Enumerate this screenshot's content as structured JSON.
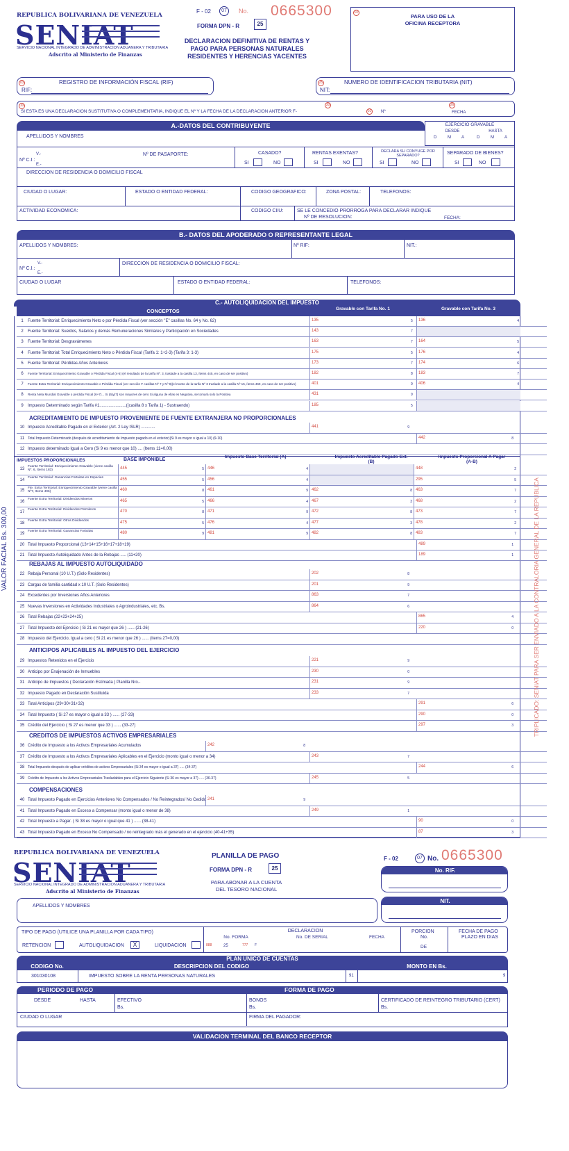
{
  "header": {
    "republic": "REPUBLICA BOLIVARIANA DE VENEZUELA",
    "logo": "SENIAT",
    "service": "SERVICIO NACIONAL INTEGRADO DE ADMINISTRACION ADUANERA Y TRIBUTARIA",
    "ministry": "Adscrito al Ministerio de Finanzas",
    "form_code": "F - 02",
    "circle_07": "07",
    "no_label": "No.",
    "serial": "0665300",
    "forma_label": "FORMA  DPN - R",
    "forma_num": "25",
    "title_1": "DECLARACION DEFINITIVA DE RENTAS Y",
    "title_2": "PAGO PARA PERSONAS NATURALES",
    "title_3": "RESIDENTES Y HERENCIAS YACENTES",
    "office_circle": "02",
    "office_1": "PARA USO DE LA",
    "office_2": "OFICINA RECEPTORA"
  },
  "ids": {
    "rif_title": "REGISTRO DE INFORMACIÓN FISCAL (RIF)",
    "rif_label": "RIF:",
    "rif_circle": "03",
    "nit_title": "NUMERO DE IDENTIFICACION TRIBUTARIA (NIT)",
    "nit_label": "NIT:",
    "nit_circle": "25",
    "sustitutiva": "SI ESTA ES UNA DECLARACION SUSTITUTIVA O COMPLEMENTARIA, INDIQUE EL Nº Y LA FECHA DE LA DECLARACION ANTERIOR F-",
    "sust_no": "Nº",
    "sust_fecha": "FECHA",
    "sust_circle_a": "10",
    "sust_circle_b": "30",
    "sust_circle_c": "01",
    "sust_circle_d": "26"
  },
  "sectionA": {
    "title": "A.-DATOS DEL CONTRIBUYENTE",
    "ejercicio": "EJERCICIO GRAVABLE",
    "desde": "DESDE",
    "hasta": "HASTA",
    "dma": [
      "D",
      "M",
      "A",
      "D",
      "M",
      "A"
    ],
    "apellidos": "APELLIDOS Y NOMBRES",
    "ci": "Nº C.I.:",
    "v": "V.-",
    "e": "E.-",
    "pasaporte": "Nº DE PASAPORTE:",
    "casado": "CASADO?",
    "exentas": "RENTAS EXENTAS?",
    "declara": "DECLARA SU CONYUGE POR SEPARADO?",
    "separado": "SEPARADO DE BIENES?",
    "si": "SI",
    "no": "NO",
    "direccion": "DIRECCION DE RESIDENCIA O DOMICILIO FISCAL",
    "ciudad": "CIUDAD O LUGAR:",
    "estado": "ESTADO O ENTIDAD FEDERAL:",
    "codigo_geo": "CODIGO GEOGRAFICO:",
    "zona": "ZONA POSTAL:",
    "telefonos": "TELEFONOS:",
    "actividad": "ACTIVIDAD ECONOMICA:",
    "ciiu": "CODIGO CIIU:",
    "prorroga": "SE LE CONCEDIO PRORROGA PARA DECLARAR INDIQUE",
    "resolucion": "Nº DE RESOLUCION:",
    "fecha": "FECHA:"
  },
  "sectionB": {
    "title": "B.- DATOS DEL APODERADO O REPRESENTANTE LEGAL",
    "apellidos": "APELLIDOS Y NOMBRES:",
    "rif": "Nº RIF:",
    "nit": "NIT.:",
    "ci": "Nº C.I.:",
    "v": "V.-",
    "e": "E.-",
    "direccion": "DIRECCION DE RESIDENCIA O DOMICILIO FISCAL:",
    "ciudad": "CIUDAD O LUGAR",
    "estado": "ESTADO O ENTIDAD FEDERAL:",
    "telefonos": "TELEFONOS:"
  },
  "sectionC": {
    "title": "C.- AUTOLIQUIDACION DEL IMPUESTO",
    "conceptos": "CONCEPTOS",
    "tarifa1": "Gravable con Tarifa No. 1",
    "tarifa3": "Gravable con Tarifa No. 3",
    "rows_a": [
      {
        "n": "1",
        "label": "Fuente Territorial: Enriquecimiento Neto o por Pérdida Fiscal (ver sección \"E\" casillas No. 64 y No. 62)",
        "c1": "135",
        "d1": "5",
        "c3": "136",
        "d3": "4"
      },
      {
        "n": "2",
        "label": "Fuente Territorial: Sueldos, Salarios y demás Remuneraciones Similares y Participación en Sociedades",
        "c1": "143",
        "d1": "7",
        "c3": "",
        "d3": ""
      },
      {
        "n": "3",
        "label": "Fuente Territorial: Desgravámenes",
        "c1": "163",
        "d1": "7",
        "c3": "164",
        "d3": "5"
      },
      {
        "n": "4",
        "label": "Fuente Territorial: Total Enriquecimiento Neto o Pérdida Fiscal (Tarifa 1: 1+2-3) (Tarifa 3: 1-3)",
        "c1": "175",
        "d1": "5",
        "c3": "176",
        "d3": "4"
      },
      {
        "n": "5",
        "label": "Fuente Territorial: Pérdidas Años Anteriores",
        "c1": "173",
        "d1": "7",
        "c3": "174",
        "d3": "6"
      },
      {
        "n": "6",
        "label": "Fuente Territorial: Enriquecimiento Gravable o Pérdida Fiscal     (4-5) (el resultado de la tarifa Nº. 3, traslade a la casilla 13, ítems 445, en caso de ser positivo)",
        "c1": "182",
        "d1": "8",
        "c3": "183",
        "d3": "7"
      },
      {
        "n": "7",
        "label": "Fuente Extra Territorial: Enriquecimiento Gravable o Pérdida Fiscal (ver sección F casillas Nº 7 y Nº 8)(el monto de la tarifa Nº 3 traslade a la casilla Nº 15, ítems 460, en caso de ser positivo)",
        "c1": "401",
        "d1": "9",
        "c3": "406",
        "d3": "4"
      },
      {
        "n": "8",
        "label": "Renta Neta Mundial Gravable o pérdida Fiscal          (6+7)... Si (6)y(7) son mayores de cero          Si alguna de ellas es Negativa, se tomará solo la Positiva",
        "c1": "431",
        "d1": "9",
        "c3": "",
        "d3": ""
      },
      {
        "n": "9",
        "label": "Impuesto Determinado según Tarifa #1.......................((casilla 8 x Tarifa 1) - Sustraendo)",
        "c1": "185",
        "d1": "5",
        "c3": "",
        "d3": ""
      }
    ],
    "acred_title": "ACREDITAMIENTO DE IMPUESTO PROVENIENTE DE FUENTE EXTRANJERA NO PROPORCIONALES",
    "rows_b": [
      {
        "n": "10",
        "label": "Impuesto Acreditable Pagado en el Exterior (Art. 2 Ley ISLR) ............",
        "c": "441",
        "d": "9",
        "pos": "mid"
      },
      {
        "n": "11",
        "label": "Total Impuesto Determinado (después de acreditamiento de Impuesto pagado en el exterior)(Si 9 es mayor o igual a 10)    (9-10)",
        "c": "442",
        "d": "8",
        "pos": "right"
      },
      {
        "n": "12",
        "label": "Impuesto determinado Igual a Cero (Si 9 es menor que 10) .... (Items 11=0,00)",
        "c": "",
        "d": "",
        "pos": "none"
      }
    ],
    "prop_header": {
      "impuestos": "IMPUESTOS PROPORCIONALES",
      "base": "BASE IMPONIBLE",
      "territorial": "Impuesto Base Territorial (A)",
      "acreditable": "Impuesto Acreditable Pagado Ext. (B)",
      "proporcional": "Impuesto Proporcional A Pagar (A-B)"
    },
    "rows_prop": [
      {
        "n": "13",
        "label": "Fuente Territorial: Enriquecimiento Gravable (viene casilla Nº. 6, Items 183)",
        "b": "445",
        "bd": "5",
        "t": "446",
        "td": "4",
        "a": "",
        "ad": "",
        "p": "448",
        "pd": "2"
      },
      {
        "n": "14",
        "label": "Fuente Territorial: Ganancias Fortuitas en Especies",
        "b": "455",
        "bd": "5",
        "t": "456",
        "td": "4",
        "a": "",
        "ad": "",
        "p": "295",
        "pd": "5"
      },
      {
        "n": "15",
        "label": "Fte. Extra Territorial: Enriquecimiento Gravable (viene casilla Nº7, Items 406)",
        "b": "460",
        "bd": "8",
        "t": "461",
        "td": "9",
        "a": "462",
        "ad": "8",
        "p": "463",
        "pd": "7"
      },
      {
        "n": "16",
        "label": "Fuente Extra Territorial: Dividendos Mineros",
        "b": "465",
        "bd": "5",
        "t": "466",
        "td": "4",
        "a": "467",
        "ad": "3",
        "p": "468",
        "pd": "2"
      },
      {
        "n": "17",
        "label": "Fuente Extra Territorial: Dividendos Petroleros",
        "b": "470",
        "bd": "8",
        "t": "471",
        "td": "9",
        "a": "472",
        "ad": "8",
        "p": "473",
        "pd": "7"
      },
      {
        "n": "18",
        "label": "Fuente Extra Territorial: Otros Dividendos",
        "b": "475",
        "bd": "5",
        "t": "476",
        "td": "4",
        "a": "477",
        "ad": "3",
        "p": "478",
        "pd": "2"
      },
      {
        "n": "19",
        "label": "Fuente Extra Territorial: Ganancias Fortuitas",
        "b": "480",
        "bd": "9",
        "t": "481",
        "td": "9",
        "a": "482",
        "ad": "8",
        "p": "483",
        "pd": "7"
      }
    ],
    "rows_tot": [
      {
        "n": "20",
        "label": "Total Impuesto Proporcional (13+14+15+16+17+18+19)",
        "c": "489",
        "d": "1",
        "pos": "right"
      },
      {
        "n": "21",
        "label": "Total Impuesto Autoliquidado Antes de la Rebajas ..... (11+20)",
        "c": "189",
        "d": "1",
        "pos": "right"
      }
    ],
    "rebajas_title": "REBAJAS AL IMPUESTO AUTOLIQUIDADO",
    "rows_reb": [
      {
        "n": "22",
        "label": "Rebaja Personal (10 U.T.) (Solo Residentes)",
        "c": "202",
        "d": "8",
        "pos": "mid"
      },
      {
        "n": "23",
        "label": "Cargas de familia cantidad     x 10 U.T. (Solo Residentes)",
        "c": "201",
        "d": "9",
        "pos": "mid"
      },
      {
        "n": "24",
        "label": "Excedentes por Inversiones Años Anteriores",
        "c": "863",
        "d": "7",
        "pos": "mid"
      },
      {
        "n": "25",
        "label": "Nuevas Inversiones en Actividades Industriales o Agroindustriales, etc. Bs.",
        "c": "864",
        "d": "6",
        "pos": "mid"
      },
      {
        "n": "26",
        "label": "Total Rebajas           (22+23+24+25)",
        "c": "865",
        "d": "4",
        "pos": "right"
      },
      {
        "n": "27",
        "label": "Total Impuesto del Ejercicio ( Si 21 es mayor que 26 ) ...... (21-26)",
        "c": "220",
        "d": "0",
        "pos": "right"
      },
      {
        "n": "28",
        "label": "Impuesto del Ejercicio, Igual a cero ( Si 21 es menor que 26 ) ...... (Items 27=0,00)",
        "c": "",
        "d": "",
        "pos": "none"
      }
    ],
    "anticipos_title": "ANTICIPOS APLICABLES AL IMPUESTO DEL EJERCICIO",
    "rows_ant": [
      {
        "n": "29",
        "label": "Impuestos Retenidos en el Ejercicio",
        "c": "221",
        "d": "9",
        "pos": "mid"
      },
      {
        "n": "30",
        "label": "Anticipo por Enajenación de Inmuebles",
        "c": "230",
        "d": "0",
        "pos": "mid"
      },
      {
        "n": "31",
        "label": "Anticipo de Impuestos ( Declaración Estimada ) Planilla Nro.-",
        "c": "231",
        "d": "9",
        "pos": "mid"
      },
      {
        "n": "32",
        "label": "Impuesto Pagado en Declaración Sustituida",
        "c": "233",
        "d": "7",
        "pos": "mid"
      },
      {
        "n": "33",
        "label": "Total Anticipos          (29+30+31+32)",
        "c": "291",
        "d": "6",
        "pos": "right"
      },
      {
        "n": "34",
        "label": "Total Impuesto ( Si 27 es mayor o igual a 33 ) ...... (27-33)",
        "c": "290",
        "d": "0",
        "pos": "right"
      },
      {
        "n": "35",
        "label": "Crédito del Ejercicio ( Si 27 es menor que 33 ) ...... (33-27)",
        "c": "297",
        "d": "3",
        "pos": "right"
      }
    ],
    "creditos_title": "CREDITOS DE IMPUESTOS ACTIVOS EMPRESARIALES",
    "rows_cred": [
      {
        "n": "36",
        "label": "Crédito de Impuesto a los Activos Empresariales Acumulados",
        "c": "242",
        "d": "8",
        "pos": "left"
      },
      {
        "n": "37",
        "label": "Crédito de Impuesto a los Activos Empresariales Aplicables en el Ejercicio (monto igual o menor a 34)",
        "c": "243",
        "d": "7",
        "pos": "mid"
      },
      {
        "n": "38",
        "label": "Total Impuesto después de aplicar créditos de activos Empresariales (Si 34 es mayor o igual a 37) ..... (34-37)",
        "c": "244",
        "d": "6",
        "pos": "right"
      },
      {
        "n": "39",
        "label": "Crédito de Impuesto a los Activos Empresariales Trasladables para el Ejercicio Siguiente (Si 36 es mayor a 37) ..... (36-37)",
        "c": "245",
        "d": "5",
        "pos": "mid"
      }
    ],
    "compens_title": "COMPENSACIONES",
    "rows_comp": [
      {
        "n": "40",
        "label": "Total Impuesto Pagado en Ejercicios Anteriores No Compensados / No Reintegrados/ No Cedido",
        "c": "241",
        "d": "9",
        "pos": "left"
      },
      {
        "n": "41",
        "label": "Total Impuesto Pagado en Exceso a Compensar (monto igual o menor de 38)",
        "c": "249",
        "d": "1",
        "pos": "mid"
      },
      {
        "n": "42",
        "label": "Total Impuesto a Pagar. ( Si 38 es mayor o igual que 41 ) ...... (38-41)",
        "c": "90",
        "d": "0",
        "pos": "right"
      },
      {
        "n": "43",
        "label": "Total Impuesto Pagado en Exceso No Compensado / no reintegrado más el generado en el ejercicio (40-41+35)",
        "c": "87",
        "d": "3",
        "pos": "right"
      }
    ]
  },
  "side": {
    "valor": "VALOR FACIAL  Bs. 300,00",
    "triplicado": "TRIPLICADO: SENIAT PARA SER ENVIADO A LA CONTRALORIA GENERAL DE LA REPUBLICA"
  },
  "planilla": {
    "title": "PLANILLA DE PAGO",
    "forma": "FORMA  DPN - R",
    "forma_num": "25",
    "sub_1": "PARA ABONAR A LA CUENTA",
    "sub_2": "DEL TESORO NACIONAL",
    "form_code": "F - 02",
    "circle_07": "07",
    "no_label": "No.",
    "serial": "0665300",
    "rif_title": "No. RIF.",
    "nit_title": "NIT.",
    "apellidos": "APELLIDOS Y NOMBRES",
    "tipo_pago": "TIPO DE PAGO (UTILICE UNA PLANILLA POR CADA TIPO)",
    "retencion": "RETENCION",
    "autoliq": "AUTOLIQUIDACION",
    "autoliq_mark": "X",
    "liquidacion": "LIQUIDACION",
    "declaracion": "DECLARACION",
    "no_forma": "No. FORMA",
    "no_serial": "No. DE SERIAL",
    "fecha": "FECHA",
    "porcion": "PORCION",
    "porcion_no": "No.",
    "de": "DE",
    "fecha_pago": "FECHA DE PAGO",
    "plazo": "PLAZO EN DIAS",
    "code_888": "888",
    "val_25": "25",
    "code_777": "777",
    "code_f": "F",
    "plan_title": "PLAN UNICO DE CUENTAS",
    "codigo_no": "CODIGO No.",
    "descripcion": "DESCRIPCION DEL CODIGO",
    "monto": "MONTO EN Bs.",
    "codigo_val": "301030108",
    "descripcion_val": "IMPUESTO SOBRE LA RENTA PERSONAS NATURALES",
    "code_91": "91",
    "digit_9": "9",
    "periodo": "PERIODO DE PAGO",
    "forma_pago": "FORMA DE PAGO",
    "desde": "DESDE",
    "hasta": "HASTA",
    "efectivo": "EFECTIVO",
    "bonos": "BONOS",
    "certificado": "CERTIFICADO DE REINTEGRO TRIBUTARIO (CERT)",
    "bs": "Bs.",
    "ciudad": "CIUDAD O LUGAR",
    "firma": "FIRMA DEL PAGADOR:",
    "validacion": "VALIDACION TERMINAL DEL BANCO RECEPTOR"
  }
}
